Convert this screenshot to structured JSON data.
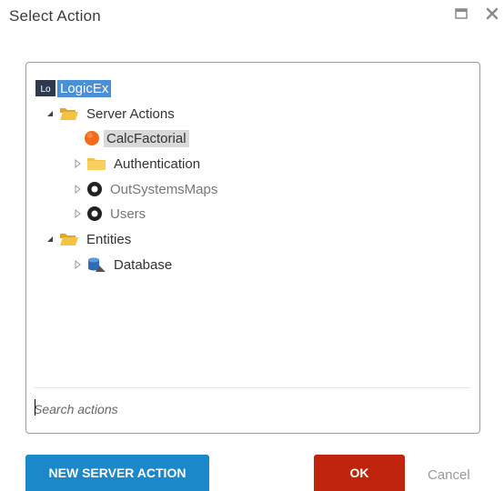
{
  "window": {
    "title": "Select Action"
  },
  "tree": {
    "root": {
      "badge": "Lo",
      "label": "LogicEx"
    },
    "items": [
      {
        "label": "Server Actions",
        "icon": "folder-open-icon",
        "expanded": true
      },
      {
        "label": "CalcFactorial",
        "icon": "server-action-icon"
      },
      {
        "label": "Authentication",
        "icon": "folder-icon",
        "expanded": false
      },
      {
        "label": "OutSystemsMaps",
        "icon": "module-icon",
        "expanded": false
      },
      {
        "label": "Users",
        "icon": "module-icon",
        "expanded": false
      },
      {
        "label": "Entities",
        "icon": "folder-open-icon",
        "expanded": true
      },
      {
        "label": "Database",
        "icon": "database-icon",
        "expanded": false
      }
    ]
  },
  "search": {
    "placeholder": "Search actions",
    "value": ""
  },
  "buttons": {
    "new_server_action": "NEW SERVER ACTION",
    "ok": "OK",
    "cancel": "Cancel"
  },
  "colors": {
    "selected_root": "#4a90d9",
    "selected_item": "#d9d9d9",
    "new_button": "#1a88c9",
    "ok_button": "#c0240c",
    "folder": "#f5c342",
    "action_orange": "#f26a1b"
  }
}
